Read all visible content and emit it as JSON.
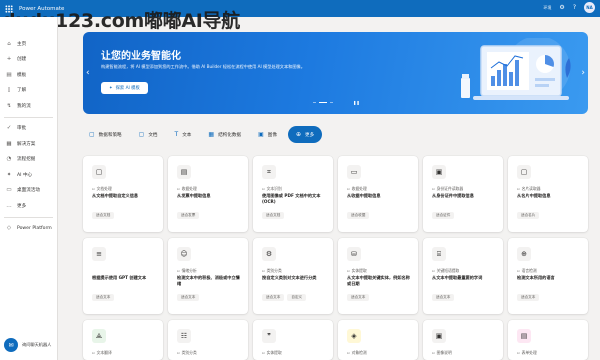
{
  "header": {
    "app_name": "Power Automate",
    "environment": "环境",
    "user_initials": "NA"
  },
  "watermark": "dudu123.com嘟嘟AI导航",
  "sidebar": {
    "items": [
      {
        "icon": "home-icon",
        "glyph": "⌂",
        "label": "主页"
      },
      {
        "icon": "create-icon",
        "glyph": "+",
        "label": "创建"
      },
      {
        "icon": "template-icon",
        "glyph": "▤",
        "label": "模板"
      },
      {
        "icon": "learn-icon",
        "glyph": "▯",
        "label": "了解"
      },
      {
        "icon": "my-flows-icon",
        "glyph": "↯",
        "label": "我的流"
      }
    ],
    "items2": [
      {
        "icon": "approvals-icon",
        "glyph": "✓",
        "label": "审批"
      },
      {
        "icon": "solutions-icon",
        "glyph": "▦",
        "label": "解决方案"
      },
      {
        "icon": "process-mining-icon",
        "glyph": "◔",
        "label": "流程挖掘"
      },
      {
        "icon": "ai-hub-icon",
        "glyph": "✦",
        "label": "AI 中心"
      },
      {
        "icon": "desktop-flows-icon",
        "glyph": "▭",
        "label": "桌面流活动"
      },
      {
        "icon": "more-icon",
        "glyph": "…",
        "label": "更多"
      }
    ],
    "power_platform": "Power Platform",
    "chatbot_label": "询问聊天机器人"
  },
  "banner": {
    "title": "让您的业务智能化",
    "description": "构建智能流程，将 AI 模型添加到您的工作流中。借助 AI Builder 轻松在流程中使用 AI 模型处理文本和图像。",
    "button_label": "探索 AI 模板"
  },
  "chips": [
    {
      "icon": "document-icon",
      "label": "数据和策略"
    },
    {
      "icon": "document-icon",
      "label": "文档"
    },
    {
      "icon": "text-icon",
      "label": "文本"
    },
    {
      "icon": "structured-data-icon",
      "label": "结构化数据"
    },
    {
      "icon": "image-icon",
      "label": "图像"
    },
    {
      "icon": "more-icon",
      "label": "更多"
    }
  ],
  "cards": [
    {
      "icon": "document-icon",
      "glyph": "▢",
      "bg": "#f3f2f1",
      "category": "文档处理",
      "title": "从文档中提取自定义信息",
      "tags": [
        "适合文档"
      ]
    },
    {
      "icon": "receipt-icon",
      "glyph": "▤",
      "bg": "#f3f2f1",
      "category": "收据处理",
      "title": "从发票中提取信息",
      "tags": [
        "适合发票"
      ]
    },
    {
      "icon": "scan-icon",
      "glyph": "⌗",
      "bg": "#f3f2f1",
      "category": "文本识别",
      "title": "使用图像或 PDF 文档中的文本 (OCR)",
      "tags": [
        "适合文档"
      ]
    },
    {
      "icon": "id-card-icon",
      "glyph": "▭",
      "bg": "#f3f2f1",
      "category": "收据处理",
      "title": "从收据中提取信息",
      "tags": [
        "适合收据"
      ]
    },
    {
      "icon": "id-card-icon",
      "glyph": "▣",
      "bg": "#f3f2f1",
      "category": "身份证件读取器",
      "title": "从身份证件中提取信息",
      "tags": [
        "适合证件"
      ]
    },
    {
      "icon": "business-card-icon",
      "glyph": "▢",
      "bg": "#f3f2f1",
      "category": "名片读取器",
      "title": "从名片中提取信息",
      "tags": [
        "适合名片"
      ]
    },
    {
      "icon": "text-gen-icon",
      "glyph": "≡",
      "bg": "#f3f2f1",
      "category": "",
      "title": "根据提示使用 GPT 创建文本",
      "tags": [
        "适合文本"
      ]
    },
    {
      "icon": "sentiment-icon",
      "glyph": "☺",
      "bg": "#f3f2f1",
      "category": "情绪分析",
      "title": "检测文本中的积极、消极或中立情绪",
      "tags": [
        "适合文本"
      ]
    },
    {
      "icon": "classify-icon",
      "glyph": "⚙",
      "bg": "#f3f2f1",
      "category": "类别分类",
      "title": "按自定义类别对文本进行分类",
      "tags": [
        "适合文本",
        "自定义"
      ]
    },
    {
      "icon": "entity-icon",
      "glyph": "⛁",
      "bg": "#f3f2f1",
      "category": "实体提取",
      "title": "从文本中提取关键实体，例如名称或日期",
      "tags": [
        "适合文本"
      ]
    },
    {
      "icon": "key-phrase-icon",
      "glyph": "⌸",
      "bg": "#f3f2f1",
      "category": "关键短语提取",
      "title": "从文本中提取最重要的字词",
      "tags": [
        "适合文本"
      ]
    },
    {
      "icon": "language-icon",
      "glyph": "⊕",
      "bg": "#f3f2f1",
      "category": "语言检测",
      "title": "检测文本所用的语言",
      "tags": [
        "适合文本"
      ]
    },
    {
      "icon": "translate-icon",
      "glyph": "⟁",
      "bg": "#e8f5e9",
      "category": "文本翻译",
      "title": "",
      "tags": []
    },
    {
      "icon": "checklist-icon",
      "glyph": "☷",
      "bg": "#f3f2f1",
      "category": "类别分类",
      "title": "",
      "tags": []
    },
    {
      "icon": "quote-icon",
      "glyph": "❞",
      "bg": "#f3f2f1",
      "category": "实体提取",
      "title": "",
      "tags": []
    },
    {
      "icon": "object-detect-icon",
      "glyph": "◈",
      "bg": "#fff8d6",
      "category": "对象检测",
      "title": "",
      "tags": []
    },
    {
      "icon": "image-desc-icon",
      "glyph": "▣",
      "bg": "#f3f2f1",
      "category": "图像说明",
      "title": "",
      "tags": []
    },
    {
      "icon": "form-icon",
      "glyph": "▤",
      "bg": "#fde7f3",
      "category": "表单处理",
      "title": "",
      "tags": []
    }
  ]
}
